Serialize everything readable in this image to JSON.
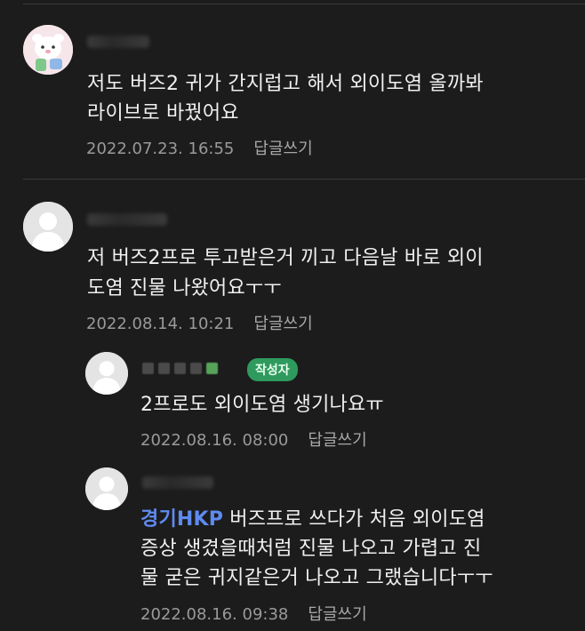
{
  "comments": [
    {
      "text_line1": "저도 버즈2 귀가 간지럽고 해서 외이도염 올까봐",
      "text_line2": "라이브로 바꿨어요",
      "date": "2022.07.23. 16:55",
      "reply_label": "답글쓰기"
    },
    {
      "text_line1": "저 버즈2프로 투고받은거 끼고 다음날 바로 외이",
      "text_line2": "도염 진물 나왔어요ㅜㅜ",
      "date": "2022.08.14. 10:21",
      "reply_label": "답글쓰기"
    }
  ],
  "replies": [
    {
      "author_badge": "작성자",
      "text_line1": "2프로도 외이도염 생기나요ㅠ",
      "date": "2022.08.16. 08:00",
      "reply_label": "답글쓰기"
    },
    {
      "mention": "경기HKP",
      "text_line1_rest": " 버즈프로 쓰다가 처음 외이도염",
      "text_line2": "증상 생겼을때처럼 진물 나오고 가렵고 진",
      "text_line3": "물 굳은 귀지같은거 나오고 그랬습니다ㅜㅜ",
      "date": "2022.08.16. 09:38",
      "reply_label": "답글쓰기"
    }
  ]
}
